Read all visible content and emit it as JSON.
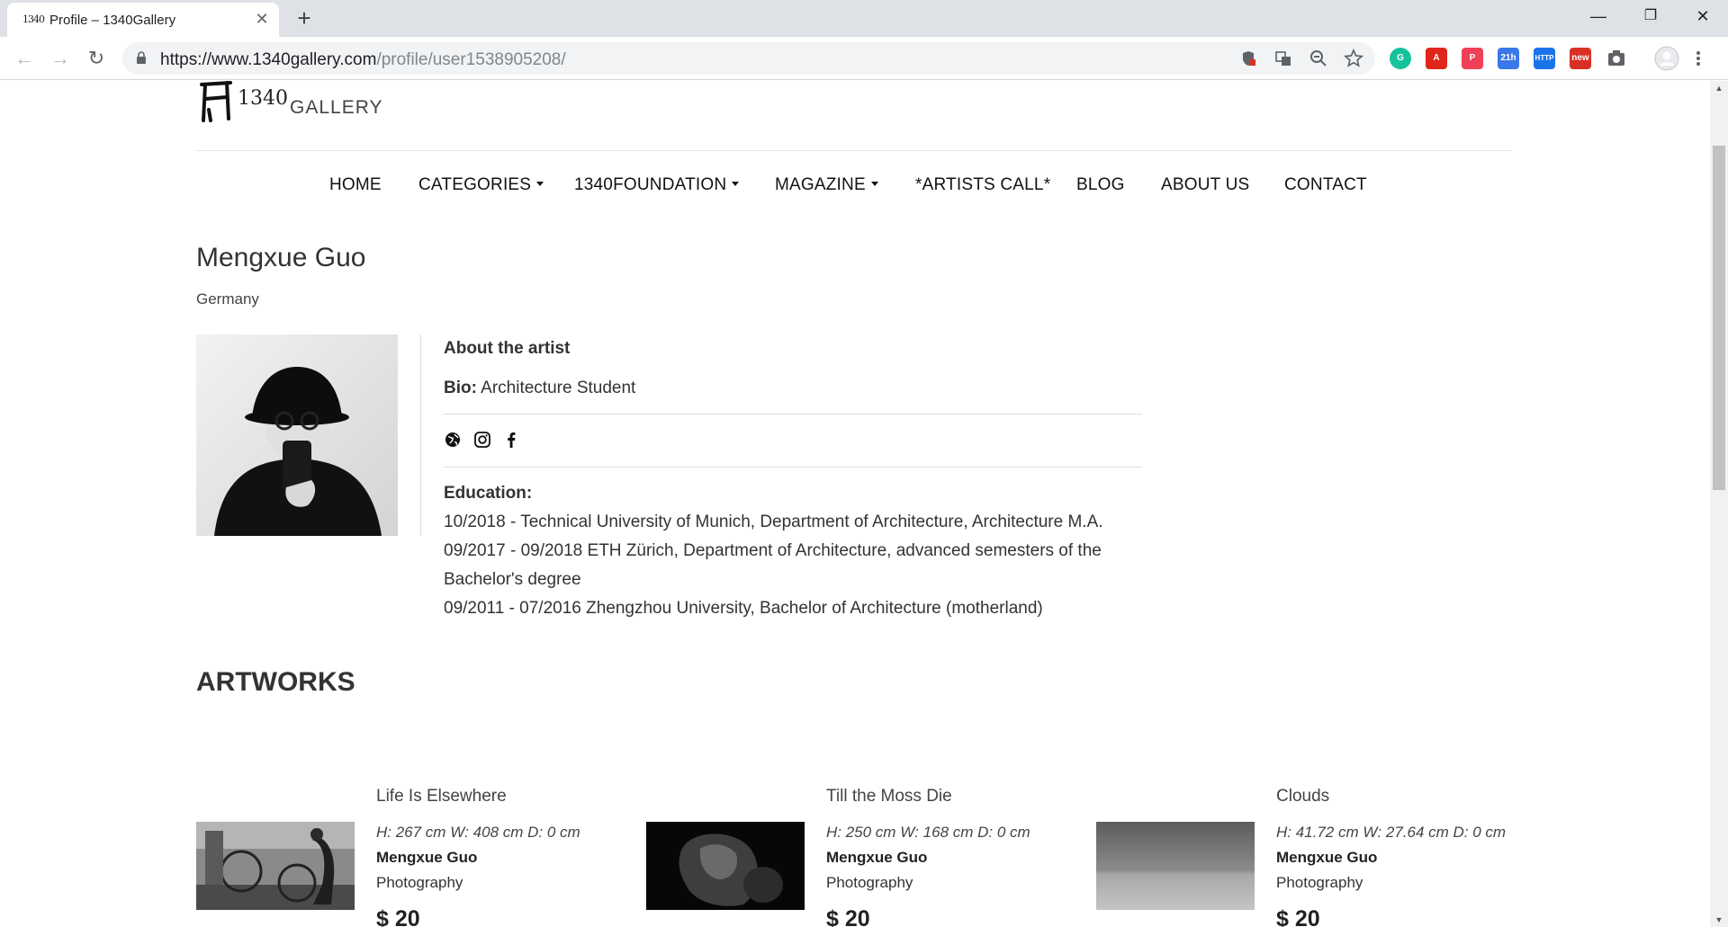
{
  "browser": {
    "tab_title": "Profile – 1340Gallery",
    "favicon_text": "1340",
    "close_tab": "✕",
    "new_tab": "+",
    "url_host": "https://www.1340gallery.com",
    "url_path": "/profile/user1538905208/",
    "window_minimize": "—",
    "window_restore": "❐",
    "window_close": "✕",
    "back": "←",
    "forward": "→",
    "reload": "↻",
    "extensions": [
      {
        "name": "grammarly-extension-icon",
        "label": "G",
        "color": "#15c39a"
      },
      {
        "name": "acrobat-extension-icon",
        "label": "A",
        "color": "#e0261b"
      },
      {
        "name": "pocket-extension-icon",
        "label": "P",
        "color": "#ef4056"
      },
      {
        "name": "calendar-extension-icon",
        "label": "21h",
        "color": "#3b78e7"
      },
      {
        "name": "http-extension-icon",
        "label": "HTTP",
        "color": "#1a73e8"
      },
      {
        "name": "new-extension-icon",
        "label": "new",
        "color": "#d93025"
      }
    ]
  },
  "site": {
    "logo_text": "GALLERY",
    "logo_mark": "1340",
    "nav": [
      {
        "label": "HOME",
        "dropdown": false
      },
      {
        "label": "CATEGORIES",
        "dropdown": true
      },
      {
        "label": "1340FOUNDATION",
        "dropdown": true
      },
      {
        "label": "MAGAZINE",
        "dropdown": true
      },
      {
        "label": "*ARTISTS CALL*",
        "dropdown": false
      },
      {
        "label": "BLOG",
        "dropdown": false
      },
      {
        "label": "ABOUT US",
        "dropdown": false
      },
      {
        "label": "CONTACT",
        "dropdown": false
      }
    ]
  },
  "profile": {
    "name": "Mengxue Guo",
    "country": "Germany",
    "about_title": "About the artist",
    "bio_label": "Bio:",
    "bio_value": "Architecture Student",
    "social_icons": [
      "globe-icon",
      "instagram-icon",
      "facebook-icon"
    ],
    "education_title": "Education:",
    "education_lines": [
      "10/2018 - Technical University of Munich, Department of Architecture, Architecture M.A.",
      "09/2017 - 09/2018 ETH Zürich, Department of Architecture, advanced semesters of the",
      "Bachelor's degree",
      "09/2011 - 07/2016 Zhengzhou University, Bachelor of Architecture (motherland)"
    ]
  },
  "artworks": {
    "title": "ARTWORKS",
    "items": [
      {
        "title": "Life Is Elsewhere",
        "dims": "H: 267 cm W: 408 cm D: 0 cm",
        "artist": "Mengxue Guo",
        "category": "Photography",
        "price": "$ 20"
      },
      {
        "title": "Till the Moss Die",
        "dims": "H: 250 cm W: 168 cm D: 0 cm",
        "artist": "Mengxue Guo",
        "category": "Photography",
        "price": "$ 20"
      },
      {
        "title": "Clouds",
        "dims": "H: 41.72 cm W: 27.64 cm D: 0 cm",
        "artist": "Mengxue Guo",
        "category": "Photography",
        "price": "$ 20"
      }
    ]
  }
}
